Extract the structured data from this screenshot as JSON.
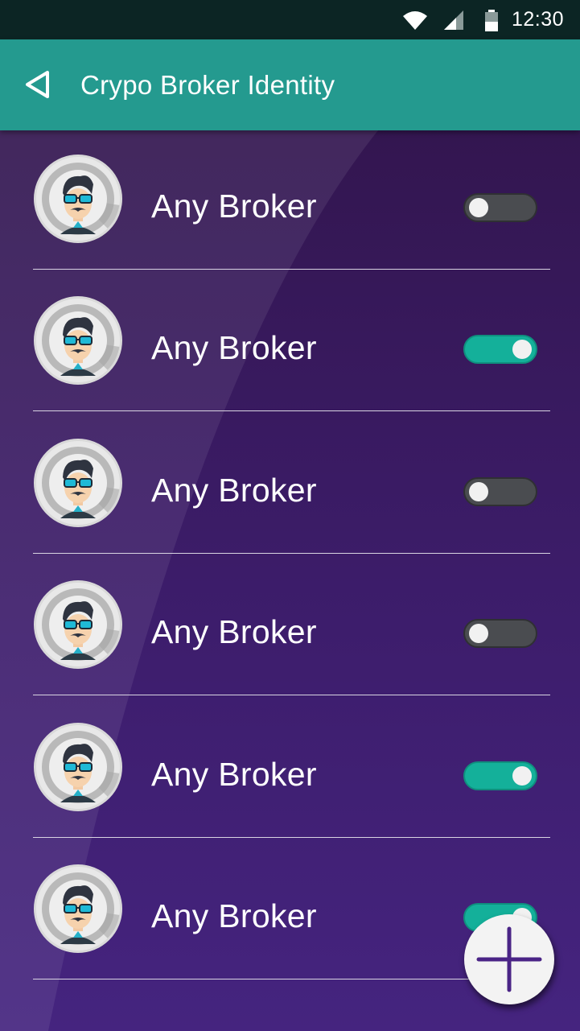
{
  "status_bar": {
    "time": "12:30",
    "icons": [
      "wifi-icon",
      "signal-icon",
      "battery-icon"
    ]
  },
  "app_bar": {
    "back_icon": "back-icon",
    "title": "Crypo Broker Identity"
  },
  "brokers": [
    {
      "name": "Any Broker",
      "enabled": false
    },
    {
      "name": "Any Broker",
      "enabled": true
    },
    {
      "name": "Any Broker",
      "enabled": false
    },
    {
      "name": "Any Broker",
      "enabled": false
    },
    {
      "name": "Any Broker",
      "enabled": true
    },
    {
      "name": "Any Broker",
      "enabled": true
    }
  ],
  "fab": {
    "icon": "plus-icon"
  },
  "colors": {
    "app_bar": "#249a8f",
    "status_bar": "#0c2524",
    "background": "#3d1d6c",
    "toggle_on": "#14b09a",
    "toggle_off": "#4a4c50",
    "fab_plus": "#4a2486"
  }
}
